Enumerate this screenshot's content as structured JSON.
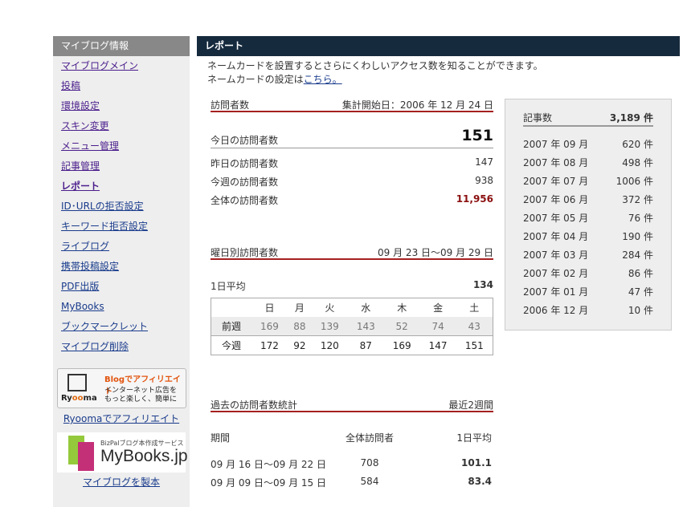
{
  "sidebar": {
    "title": "マイブログ情報",
    "items": [
      {
        "label": "マイブログメイン"
      },
      {
        "label": "投稿"
      },
      {
        "label": "環境設定"
      },
      {
        "label": "スキン変更"
      },
      {
        "label": "メニュー管理"
      },
      {
        "label": "記事管理"
      },
      {
        "label": "レポート"
      },
      {
        "label": "ID･URLの拒否設定"
      },
      {
        "label": "キーワード拒否設定"
      },
      {
        "label": "ライブログ"
      },
      {
        "label": "携帯投稿設定"
      },
      {
        "label": "PDF出版"
      },
      {
        "label": "MyBooks"
      },
      {
        "label": "ブックマークレット"
      },
      {
        "label": "マイブログ削除"
      }
    ],
    "banner_ryooma": {
      "brand_pre": "Ry",
      "brand_oo": "oo",
      "brand_post": "ma",
      "line1": "Blogでアフィリエイト",
      "line2": "インターネット広告を",
      "line3": "もっと楽しく、簡単に",
      "link": "Ryoomaでアフィリエイト"
    },
    "banner_mybooks": {
      "sub": "BizPalブログ本作成サービス",
      "brand": "MyBooks.jp",
      "link": "マイブログを製本"
    }
  },
  "header": {
    "title": "レポート"
  },
  "intro": {
    "line1": "ネームカードを設置するとさらにくわしいアクセス数を知ることができます。",
    "line2_prefix": "ネームカードの設定は",
    "line2_link": "こちら。"
  },
  "visitors": {
    "title": "訪問者数",
    "since": "集計開始日：2006 年 12 月 24 日",
    "today_label": "今日の訪問者数",
    "today_value": "151",
    "yesterday_label": "昨日の訪問者数",
    "yesterday_value": "147",
    "week_label": "今週の訪問者数",
    "week_value": "938",
    "total_label": "全体の訪問者数",
    "total_value": "11,956"
  },
  "weekday": {
    "title": "曜日別訪問者数",
    "range": "09 月 23 日～09 月 29 日",
    "avg_label": "1日平均",
    "avg_value": "134",
    "days": [
      "日",
      "月",
      "火",
      "水",
      "木",
      "金",
      "土"
    ],
    "prev_label": "前週",
    "prev": [
      "169",
      "88",
      "139",
      "143",
      "52",
      "74",
      "43"
    ],
    "cur_label": "今週",
    "cur": [
      "172",
      "92",
      "120",
      "87",
      "169",
      "147",
      "151"
    ]
  },
  "history": {
    "title": "過去の訪問者数統計",
    "scope": "最近2週間",
    "col_period": "期間",
    "col_total": "全体訪問者",
    "col_avg": "1日平均",
    "rows": [
      {
        "period": "09 月 16 日～09 月 22 日",
        "total": "708",
        "avg": "101.1"
      },
      {
        "period": "09 月 09 日～09 月 15 日",
        "total": "584",
        "avg": "83.4"
      }
    ]
  },
  "monthly": {
    "label": "記事数",
    "total": "3,189 件",
    "rows": [
      {
        "month": "2007 年 09 月",
        "count": "620 件"
      },
      {
        "month": "2007 年 08 月",
        "count": "498 件"
      },
      {
        "month": "2007 年 07 月",
        "count": "1006 件"
      },
      {
        "month": "2007 年 06 月",
        "count": "372 件"
      },
      {
        "month": "2007 年 05 月",
        "count": "76 件"
      },
      {
        "month": "2007 年 04 月",
        "count": "190 件"
      },
      {
        "month": "2007 年 03 月",
        "count": "284 件"
      },
      {
        "month": "2007 年 02 月",
        "count": "86 件"
      },
      {
        "month": "2007 年 01 月",
        "count": "47 件"
      },
      {
        "month": "2006 年 12 月",
        "count": "10 件"
      }
    ]
  },
  "colors": {
    "header_bg": "#162a3d",
    "sidebar_title_bg": "#888888",
    "accent_red": "#a52020"
  }
}
